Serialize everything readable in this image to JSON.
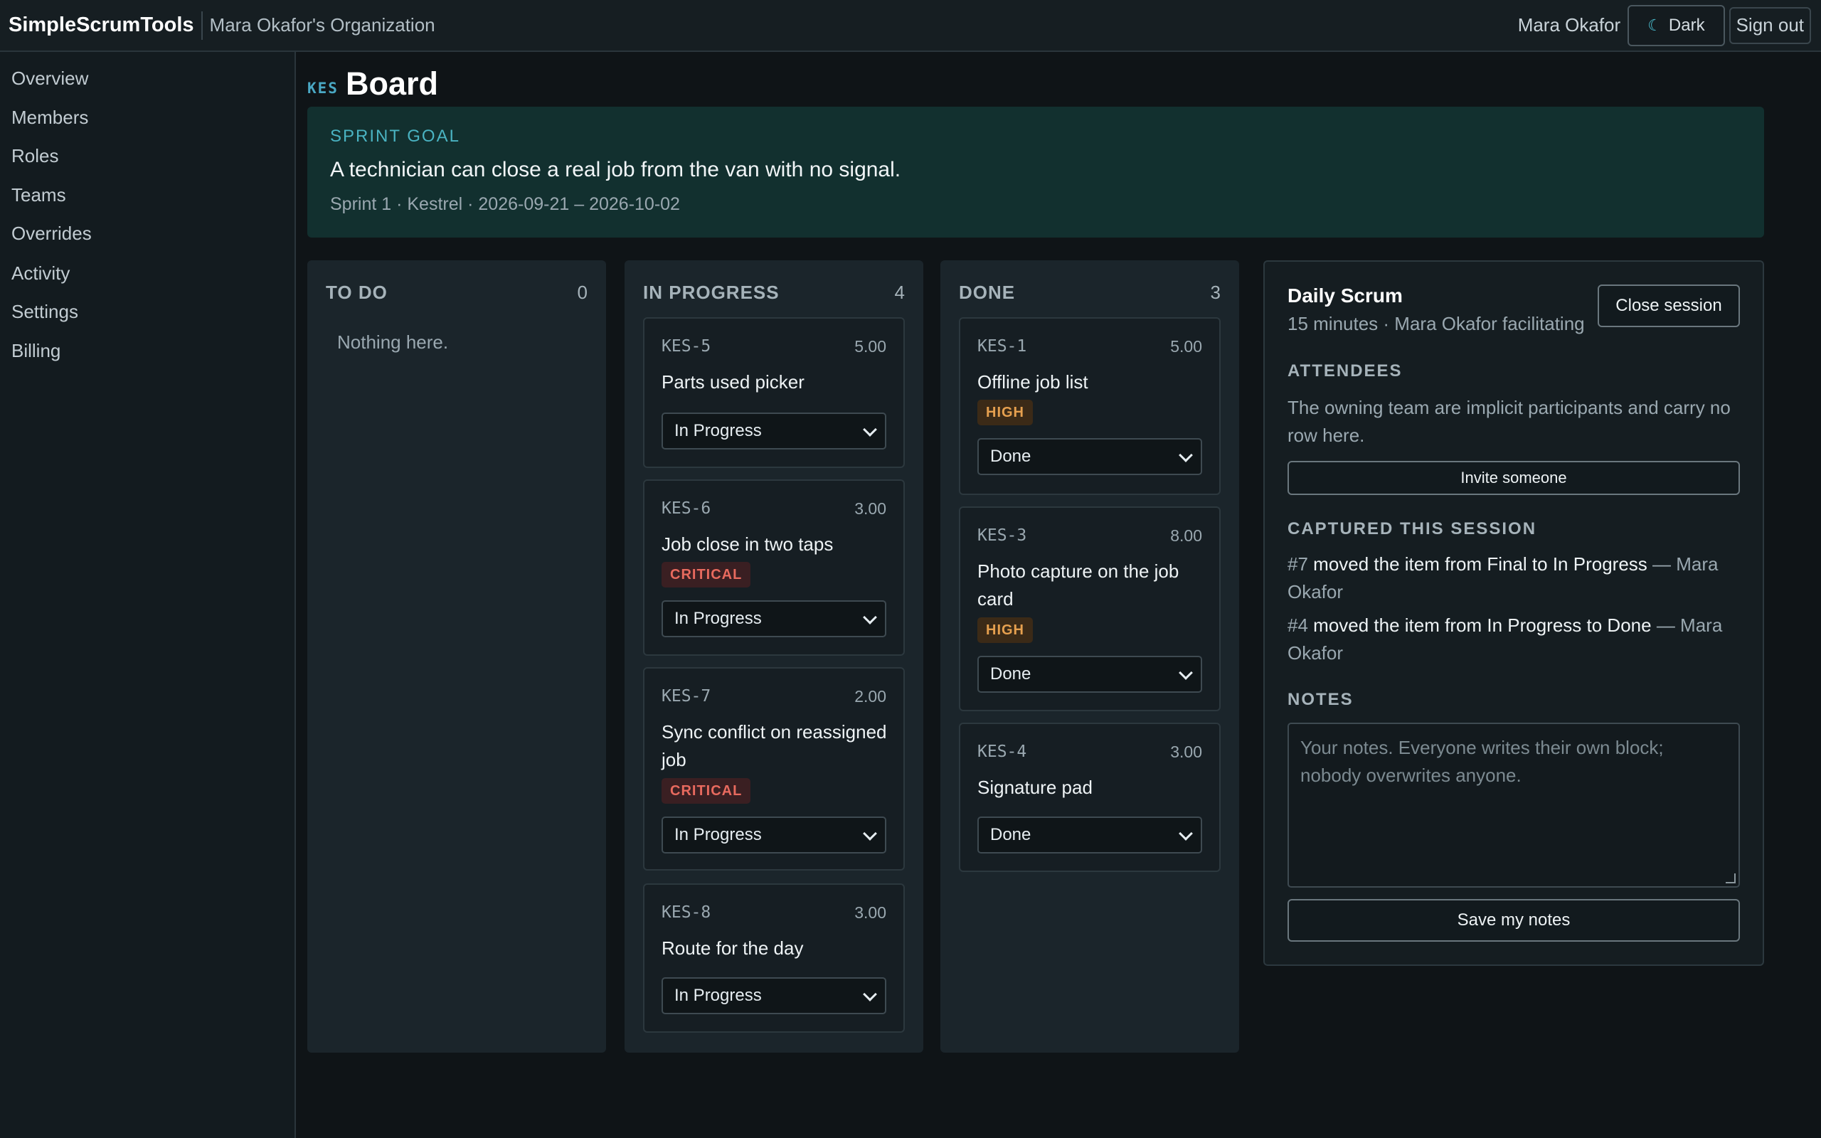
{
  "app": {
    "brand": "SimpleScrumTools",
    "organization": "Mara Okafor's Organization",
    "user": "Mara Okafor",
    "theme_icon": "moon-icon",
    "theme_label": "Dark",
    "signout_label": "Sign out"
  },
  "sidebar": {
    "items": [
      {
        "label": "Overview"
      },
      {
        "label": "Members"
      },
      {
        "label": "Roles"
      },
      {
        "label": "Teams"
      },
      {
        "label": "Overrides"
      },
      {
        "label": "Activity"
      },
      {
        "label": "Settings"
      },
      {
        "label": "Billing"
      }
    ]
  },
  "page": {
    "project_key": "KES",
    "title": "Board"
  },
  "sprint_goal": {
    "label": "SPRINT GOAL",
    "text": "A technician can close a real job from the van with no signal.",
    "meta": "Sprint 1 · Kestrel · 2026-09-21 – 2026-10-02"
  },
  "columns": [
    {
      "title": "TO DO",
      "count": "0",
      "empty_text": "Nothing here.",
      "cards": []
    },
    {
      "title": "IN PROGRESS",
      "count": "4",
      "cards": [
        {
          "key": "KES-5",
          "points": "5.00",
          "title": "Parts used picker",
          "badge": "",
          "status": "In Progress"
        },
        {
          "key": "KES-6",
          "points": "3.00",
          "title": "Job close in two taps",
          "badge": "CRITICAL",
          "status": "In Progress"
        },
        {
          "key": "KES-7",
          "points": "2.00",
          "title": "Sync conflict on reassigned job",
          "badge": "CRITICAL",
          "status": "In Progress"
        },
        {
          "key": "KES-8",
          "points": "3.00",
          "title": "Route for the day",
          "badge": "",
          "status": "In Progress"
        }
      ]
    },
    {
      "title": "DONE",
      "count": "3",
      "cards": [
        {
          "key": "KES-1",
          "points": "5.00",
          "title": "Offline job list",
          "badge": "HIGH",
          "status": "Done"
        },
        {
          "key": "KES-3",
          "points": "8.00",
          "title": "Photo capture on the job card",
          "badge": "HIGH",
          "status": "Done"
        },
        {
          "key": "KES-4",
          "points": "3.00",
          "title": "Signature pad",
          "badge": "",
          "status": "Done"
        }
      ]
    }
  ],
  "scrum": {
    "title": "Daily Scrum",
    "subtitle": "15 minutes · Mara Okafor facilitating",
    "close_label": "Close session",
    "attendees_label": "ATTENDEES",
    "attendees_text": "The owning team are implicit participants and carry no row here.",
    "invite_label": "Invite someone",
    "captured_label": "CAPTURED THIS SESSION",
    "captured": [
      {
        "ref": "#7",
        "action": "moved the item from Final to In Progress",
        "by": "— Mara Okafor"
      },
      {
        "ref": "#4",
        "action": "moved the item from In Progress to Done",
        "by": "— Mara Okafor"
      }
    ],
    "notes_label": "NOTES",
    "notes_placeholder": "Your notes. Everyone writes their own block; nobody overwrites anyone.",
    "save_label": "Save my notes"
  },
  "colors": {
    "accent": "#4ab3c2",
    "critical": "#e86a5e",
    "high": "#e6a04f",
    "background": "#0f1417"
  }
}
